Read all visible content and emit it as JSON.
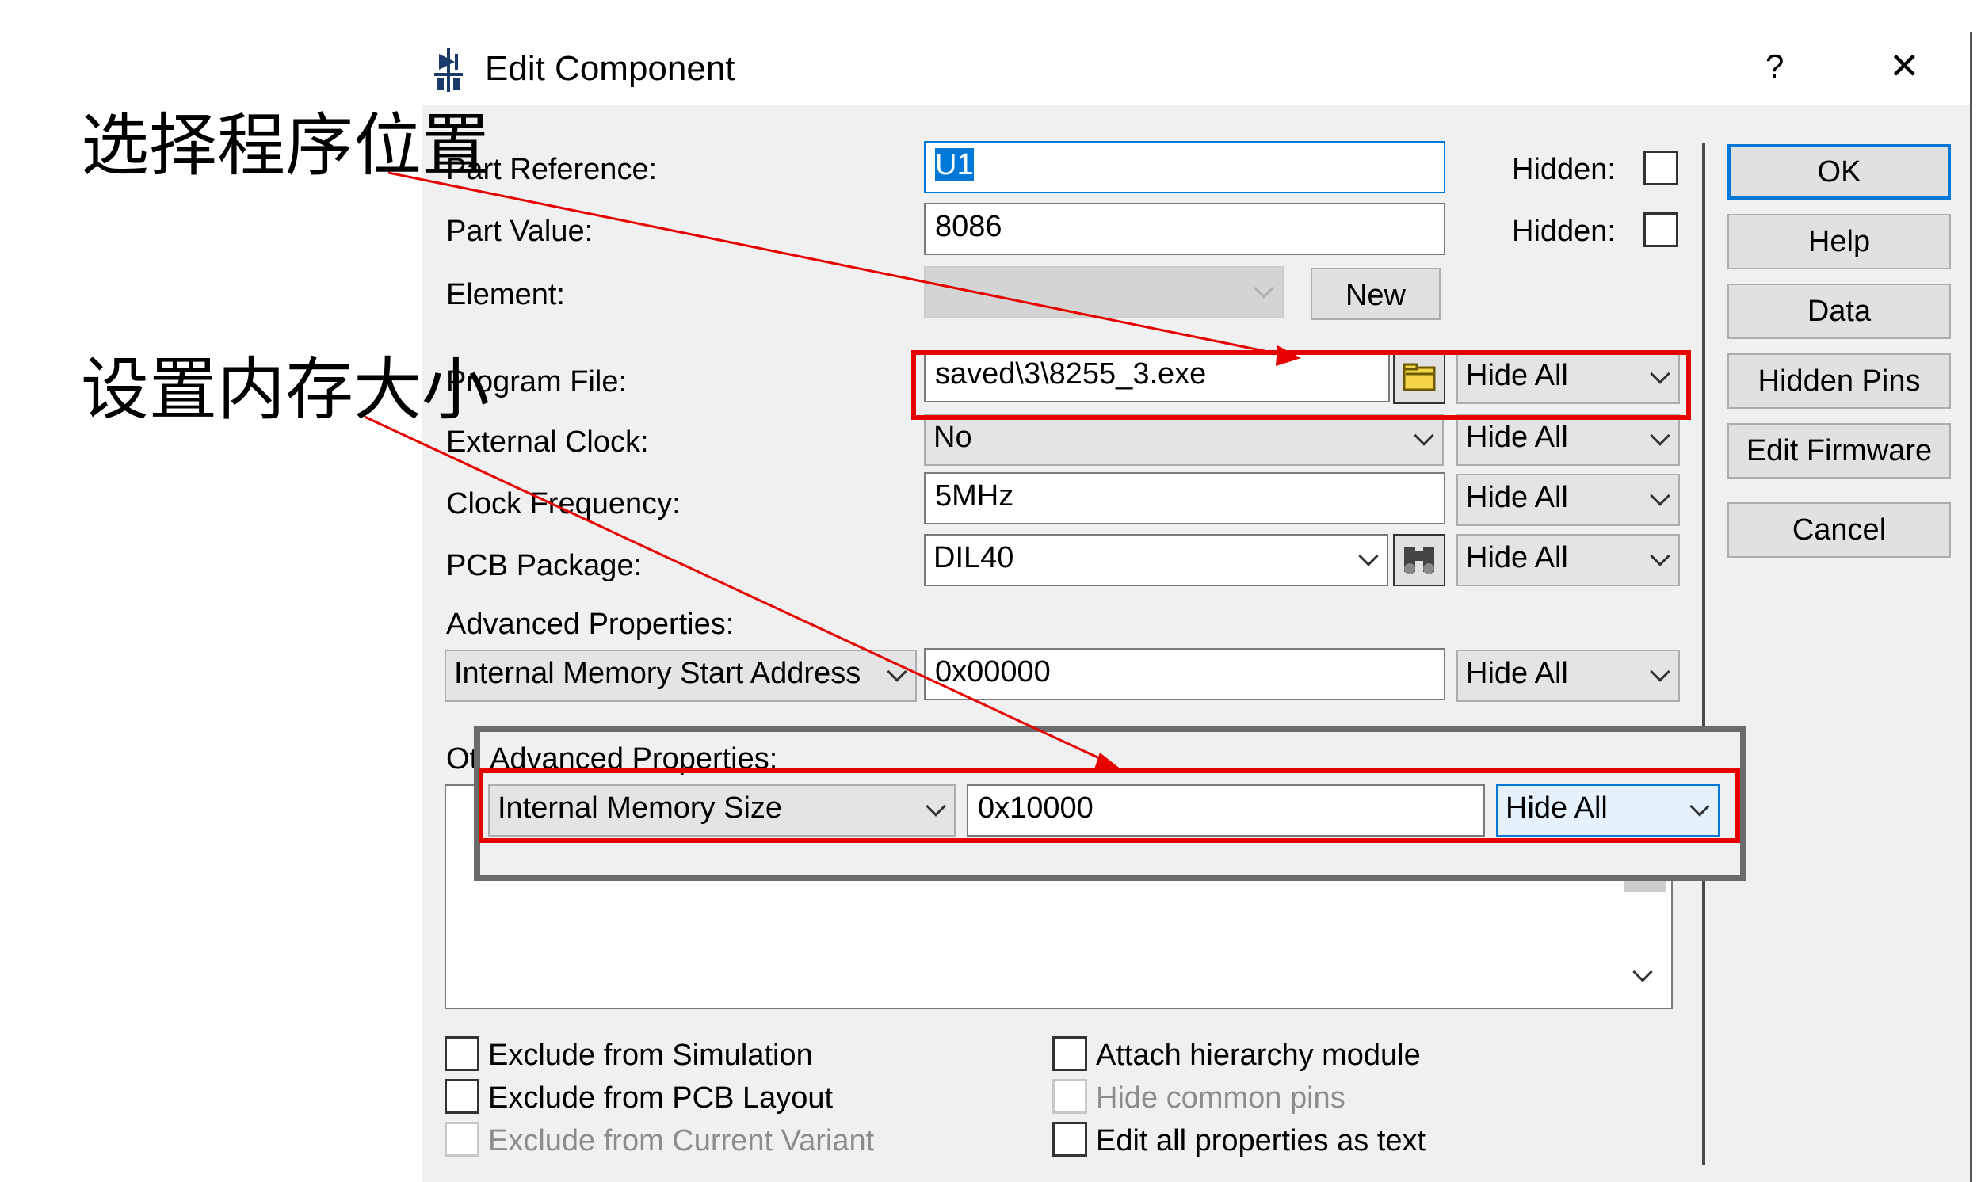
{
  "dialog": {
    "title": "Edit Component",
    "help_glyph": "?",
    "close_glyph": "✕"
  },
  "fields": {
    "part_reference_label": "Part Reference:",
    "part_reference_value": "U1",
    "part_value_label": "Part Value:",
    "part_value_value": "8086",
    "hidden_label": "Hidden:",
    "element_label": "Element:",
    "new_button": "New",
    "program_file_label": "Program File:",
    "program_file_value": "saved\\3\\8255_3.exe",
    "external_clock_label": "External Clock:",
    "external_clock_value": "No",
    "clock_frequency_label": "Clock Frequency:",
    "clock_frequency_value": "5MHz",
    "pcb_package_label": "PCB Package:",
    "pcb_package_value": "DIL40",
    "advanced_properties_label": "Advanced Properties:",
    "advanced_property_name": "Internal Memory Start Address",
    "advanced_property_value": "0x00000",
    "hide_all": "Hide All",
    "other_properties_label": "Ot"
  },
  "inset": {
    "label": "Advanced Properties:",
    "property_name": "Internal Memory Size",
    "property_value": "0x10000",
    "visibility": "Hide All"
  },
  "buttons": {
    "ok": "OK",
    "help": "Help",
    "data": "Data",
    "hidden_pins": "Hidden Pins",
    "edit_firmware": "Edit Firmware",
    "cancel": "Cancel"
  },
  "checkboxes": {
    "exclude_simulation": "Exclude from Simulation",
    "exclude_pcb": "Exclude from PCB Layout",
    "exclude_variant": "Exclude from Current Variant",
    "attach_hierarchy": "Attach hierarchy module",
    "hide_common_pins": "Hide common pins",
    "edit_as_text": "Edit all properties as text"
  },
  "annotations": {
    "select_program_location": "选择程序位置",
    "set_memory_size": "设置内存大小"
  },
  "colors": {
    "annotation_red": "#e60000",
    "selection_blue": "#0078d7",
    "inset_border": "#6b6b6b"
  }
}
